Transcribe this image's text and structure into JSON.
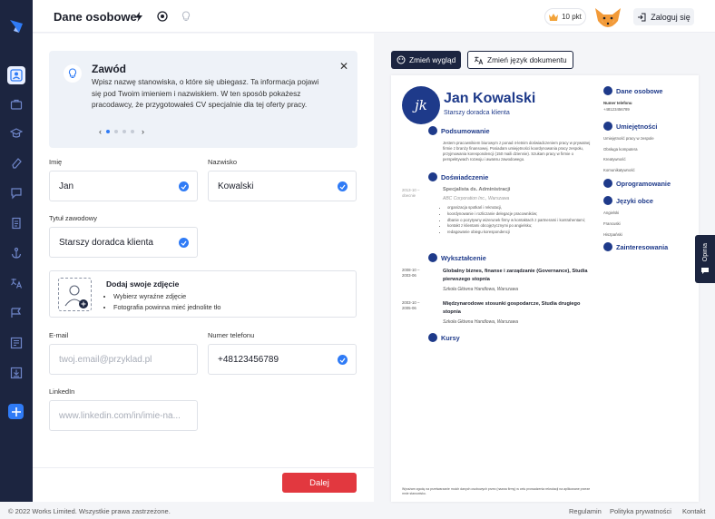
{
  "header": {
    "title": "Dane osobowe",
    "points": "10 pkt",
    "login": "Zaloguj się"
  },
  "rail": {
    "icons": [
      "user-icon",
      "briefcase-icon",
      "graduation-icon",
      "pen-icon",
      "chat-icon",
      "document-icon",
      "anchor-icon",
      "translate-icon",
      "certificate-icon",
      "layout-icon",
      "download-icon",
      "plus-icon"
    ]
  },
  "tip": {
    "title": "Zawód",
    "body": "Wpisz nazwę stanowiska, o które się ubiegasz. Ta informacja pojawi się pod Twoim imieniem i nazwiskiem. W ten sposób pokażesz pracodawcy, że przygotowałeś CV specjalnie dla tej oferty pracy.",
    "prev": "‹",
    "next": "›"
  },
  "form": {
    "first_name_label": "Imię",
    "first_name": "Jan",
    "last_name_label": "Nazwisko",
    "last_name": "Kowalski",
    "title_label": "Tytuł zawodowy",
    "title": "Starszy doradca klienta",
    "photo_title": "Dodaj swoje zdjęcie",
    "photo_tips": [
      "Wybierz wyraźne zdjęcie",
      "Fotografia powinna mieć jednolite tło"
    ],
    "email_label": "E-mail",
    "email_placeholder": "twoj.email@przyklad.pl",
    "phone_label": "Numer telefonu",
    "phone": "+48123456789",
    "linkedin_label": "LinkedIn",
    "linkedin_placeholder": "www.linkedin.com/in/imie-na..."
  },
  "next_button": "Dalej",
  "preview_buttons": {
    "layout": "Zmień wygląd",
    "lang": "Zmień język dokumentu"
  },
  "cv": {
    "initials": "jk",
    "name": "Jan Kowalski",
    "job": "Starszy doradca klienta",
    "summary_title": "Podsumowanie",
    "summary": "Jestem pracownikiem biurowym z ponad 4-letnim doświadczeniem pracy w prywatnej firmie z branży finansowej. Posiadam umiejętności koordynowania pracy zespołu, przyjmowania korespondencji (150 maili dziennie). Szukam pracy w firmie o perspektywach rozwoju i awansu zawodowego.",
    "exp_title": "Doświadczenie",
    "exp_date": "2013-10 – obecnie",
    "exp_role": "Specjalista ds. Administracji",
    "exp_company": "ABC Corporation Inc., Warszawa",
    "exp_points": [
      "organizacja spotkań i rekrutacji,",
      "koordynowanie i rozliczanie delegacje pracowników;",
      "dbanie o pozytywny wizerunek firmy w kontaktach z partnerami i kontrahentami;",
      "kontakt z klientami obcojęzycznymi po angielsku;",
      "redagowanie obiegu korespondencji"
    ],
    "edu_title": "Wykształcenie",
    "edu": [
      {
        "date": "2008-10 – 2003-06",
        "degree": "Globalny biznes, finanse i zarządzanie (Governance), Studia pierwszego stopnia",
        "school": "Szkoła Główna Handlowa, Warszawa"
      },
      {
        "date": "2003-10 – 2005-06",
        "degree": "Międzynarodowe stosunki gospodarcze, Studia drugiego stopnia",
        "school": "Szkoła Główna Handlowa, Warszawa"
      }
    ],
    "courses_title": "Kursy",
    "side": {
      "personal_title": "Dane osobowe",
      "phone_label": "Numer telefonu",
      "phone": "+48123456789",
      "skills_title": "Umiejętności",
      "skills": [
        "Umiejętność pracy w zespole",
        "Obsługa komputera",
        "Kreatywność",
        "Komunikatywność"
      ],
      "software_title": "Oprogramowanie",
      "lang_title": "Języki obce",
      "langs": [
        "Angielski",
        "Francuski",
        "Hiszpański"
      ],
      "interests_title": "Zainteresowania"
    },
    "footnote": "Wyrażam zgodę na przetwarzanie moich danych osobowych przez (nazwa firmy) w celu prowadzenia rekrutacji na aplikowane przeze mnie stanowisko."
  },
  "opinia": "Opinia",
  "footer": {
    "copyright": "© 2022 Works Limited. Wszystkie prawa zastrzeżone.",
    "links": [
      "Regulamin",
      "Polityka prywatności",
      "Kontakt"
    ]
  },
  "colors": {
    "rail": "#1c2540",
    "accent": "#2f7bf6",
    "cv_blue": "#1e3a8a",
    "next": "#e2383f"
  }
}
